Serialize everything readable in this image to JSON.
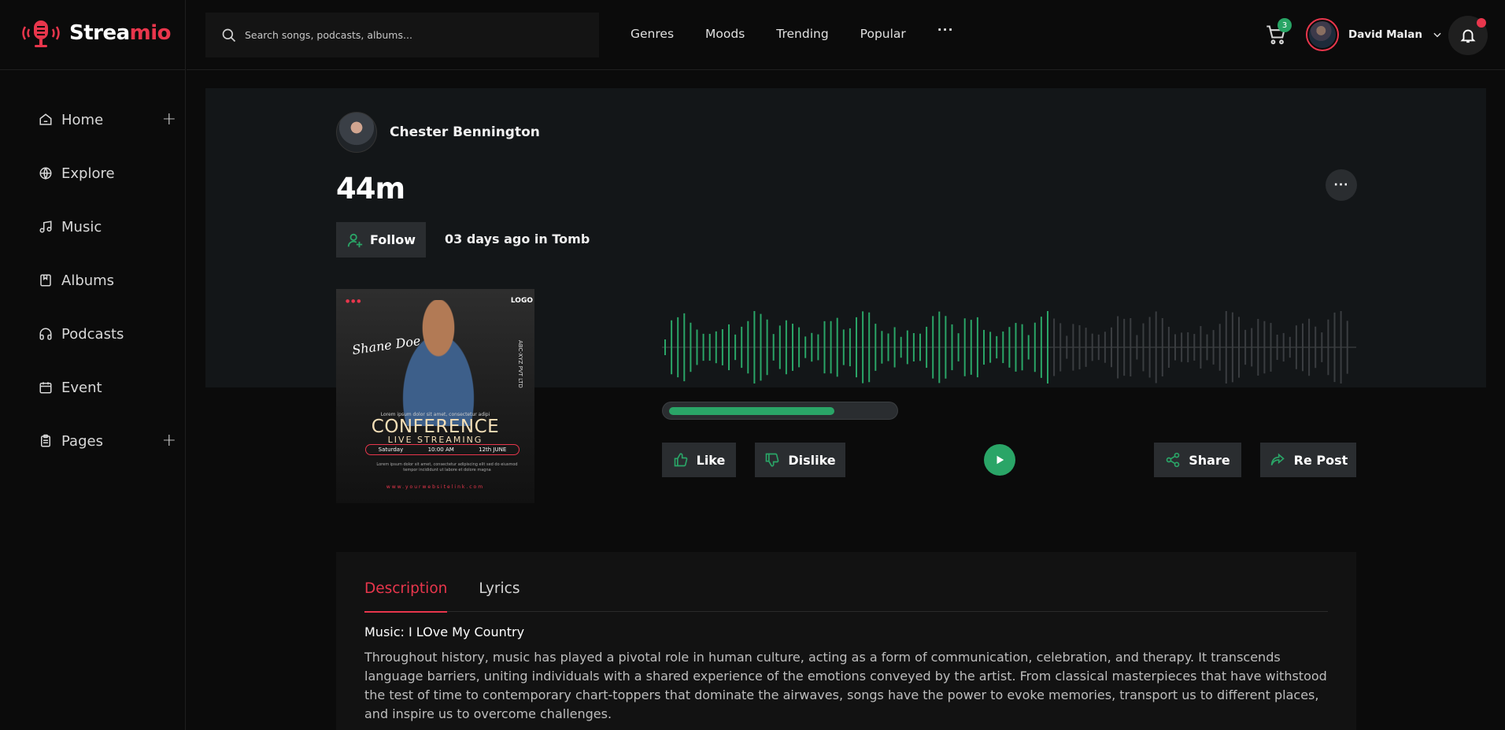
{
  "app": {
    "brand_part1": "Strea",
    "brand_part2": "mio",
    "accent": "#e8364c",
    "success": "#2aa567"
  },
  "sidebar": {
    "items": [
      {
        "label": "Home",
        "icon": "home-icon",
        "expandable": true
      },
      {
        "label": "Explore",
        "icon": "globe-icon",
        "expandable": false
      },
      {
        "label": "Music",
        "icon": "music-note-icon",
        "expandable": false
      },
      {
        "label": "Albums",
        "icon": "album-icon",
        "expandable": false
      },
      {
        "label": "Podcasts",
        "icon": "headphones-icon",
        "expandable": false
      },
      {
        "label": "Event",
        "icon": "calendar-icon",
        "expandable": false
      },
      {
        "label": "Pages",
        "icon": "clipboard-icon",
        "expandable": true
      }
    ]
  },
  "header": {
    "search_placeholder": "Search songs, podcasts, albums...",
    "nav": [
      "Genres",
      "Moods",
      "Trending",
      "Popular"
    ],
    "more": "···",
    "cart_count": "3",
    "user_name": "David Malan"
  },
  "track": {
    "artist": "Chester Bennington",
    "title": "44m",
    "follow_label": "Follow",
    "posted_prefix": "03 days ago in",
    "posted_place": "Tomb",
    "progress_fraction": 0.74,
    "played_fraction": 0.56
  },
  "cover": {
    "top_text": "● ● ●",
    "logo": "LOGO",
    "script_name": "Shane Doe",
    "side_text": "ABC-XYZ PVT LTD",
    "small_text": "Lorem ipsum dolor sit amet, consectetur adipi",
    "title": "CONFERENCE",
    "subtitle": "LIVE STREAMING",
    "day": "Saturday",
    "time": "10:00 AM",
    "date": "12th JUNE",
    "body": "Lorem ipsum dolor sit amet, consectetur adipiscing elit sed do eiusmod tempor incididunt ut labore et dolore magna",
    "url": "www.yourwebsitelink.com"
  },
  "actions": {
    "like": "Like",
    "dislike": "Dislike",
    "share": "Share",
    "repost": "Re Post"
  },
  "description": {
    "tabs": [
      "Description",
      "Lyrics"
    ],
    "heading": "Music: I LOve My Country",
    "text": "Throughout history, music has played a pivotal role in human culture, acting as a form of communication, celebration, and therapy. It transcends language barriers, uniting individuals with a shared experience of the emotions conveyed by the artist. From classical masterpieces that have withstood the test of time to contemporary chart-toppers that dominate the airwaves, songs have the power to evoke memories, transport us to different places, and inspire us to overcome challenges."
  }
}
